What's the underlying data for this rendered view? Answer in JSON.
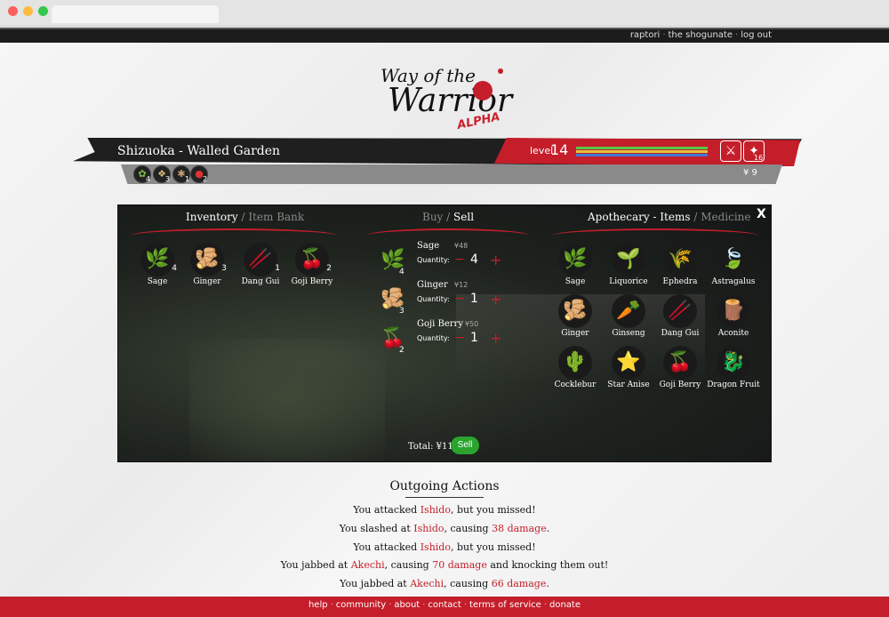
{
  "topnav": {
    "links": [
      "raptori",
      "the shogunate",
      "log out"
    ]
  },
  "logo": {
    "line1": "Way of the",
    "line2": "Warrior",
    "tag": "ALPHA"
  },
  "banner": {
    "location": "Shizuoka - Walled Garden",
    "level_label": "level",
    "level": "14",
    "stat_bars": [
      {
        "color": "#58c94a"
      },
      {
        "color": "#e0c33a"
      },
      {
        "color": "#3b78d4"
      }
    ],
    "action_icons": [
      {
        "icon": "sword-icon",
        "glyph": "⚔"
      },
      {
        "icon": "shuriken-icon",
        "glyph": "✦",
        "count": "16"
      }
    ],
    "money": "¥ 9",
    "mini_inventory": [
      {
        "icon": "sage-icon",
        "count": "4"
      },
      {
        "icon": "ginger-icon",
        "count": "3"
      },
      {
        "icon": "dang-gui-icon",
        "count": "1"
      },
      {
        "icon": "goji-berry-icon",
        "count": "2"
      }
    ]
  },
  "inventory": {
    "title": "Inventory",
    "alt_title": "Item Bank",
    "items": [
      {
        "name": "Sage",
        "count": "4",
        "glyph": "🌿"
      },
      {
        "name": "Ginger",
        "count": "3",
        "glyph": "🫚"
      },
      {
        "name": "Dang Gui",
        "count": "1",
        "glyph": "🥢"
      },
      {
        "name": "Goji Berry",
        "count": "2",
        "glyph": "🍒"
      }
    ]
  },
  "trade": {
    "title_alt": "Buy",
    "title": "Sell",
    "quantity_label": "Quantity:",
    "rows": [
      {
        "name": "Sage",
        "price": "¥48",
        "qty": "4",
        "count": "4",
        "glyph": "🌿"
      },
      {
        "name": "Ginger",
        "price": "¥12",
        "qty": "1",
        "count": "3",
        "glyph": "🫚"
      },
      {
        "name": "Goji Berry",
        "price": "¥50",
        "qty": "1",
        "count": "2",
        "glyph": "🍒"
      }
    ],
    "minus": "−",
    "plus": "+",
    "total": "Total: ¥110.",
    "sell_label": "Sell"
  },
  "apothecary": {
    "title": "Apothecary - Items",
    "alt_title": "Medicine",
    "close": "X",
    "items": [
      {
        "name": "Sage",
        "glyph": "🌿"
      },
      {
        "name": "Liquorice",
        "glyph": "🌱"
      },
      {
        "name": "Ephedra",
        "glyph": "🌾"
      },
      {
        "name": "Astragalus",
        "glyph": "🍃"
      },
      {
        "name": "Ginger",
        "glyph": "🫚"
      },
      {
        "name": "Ginseng",
        "glyph": "🥕"
      },
      {
        "name": "Dang Gui",
        "glyph": "🥢"
      },
      {
        "name": "Aconite",
        "glyph": "🪵"
      },
      {
        "name": "Cocklebur",
        "glyph": "🌵"
      },
      {
        "name": "Star Anise",
        "glyph": "⭐"
      },
      {
        "name": "Goji Berry",
        "glyph": "🍒"
      },
      {
        "name": "Dragon Fruit",
        "glyph": "🐉"
      }
    ]
  },
  "outgoing": {
    "title": "Outgoing Actions",
    "log": [
      {
        "pre": "You attacked ",
        "target": "Ishido",
        "mid": ", but you missed!",
        "damage": "",
        "post": ""
      },
      {
        "pre": "You slashed at ",
        "target": "Ishido",
        "mid": ", causing ",
        "damage": "38 damage",
        "post": "."
      },
      {
        "pre": "You attacked ",
        "target": "Ishido",
        "mid": ", but you missed!",
        "damage": "",
        "post": ""
      },
      {
        "pre": "You jabbed at ",
        "target": "Akechi",
        "mid": ", causing ",
        "damage": "70 damage",
        "post": " and knocking them out!"
      },
      {
        "pre": "You jabbed at ",
        "target": "Akechi",
        "mid": ", causing ",
        "damage": "66 damage",
        "post": "."
      }
    ]
  },
  "footer": {
    "links": [
      "help",
      "community",
      "about",
      "contact",
      "terms of service",
      "donate"
    ]
  },
  "colors": {
    "accent": "#c41e2a",
    "sell": "#2aa42e",
    "dark": "#1f1f1f"
  }
}
